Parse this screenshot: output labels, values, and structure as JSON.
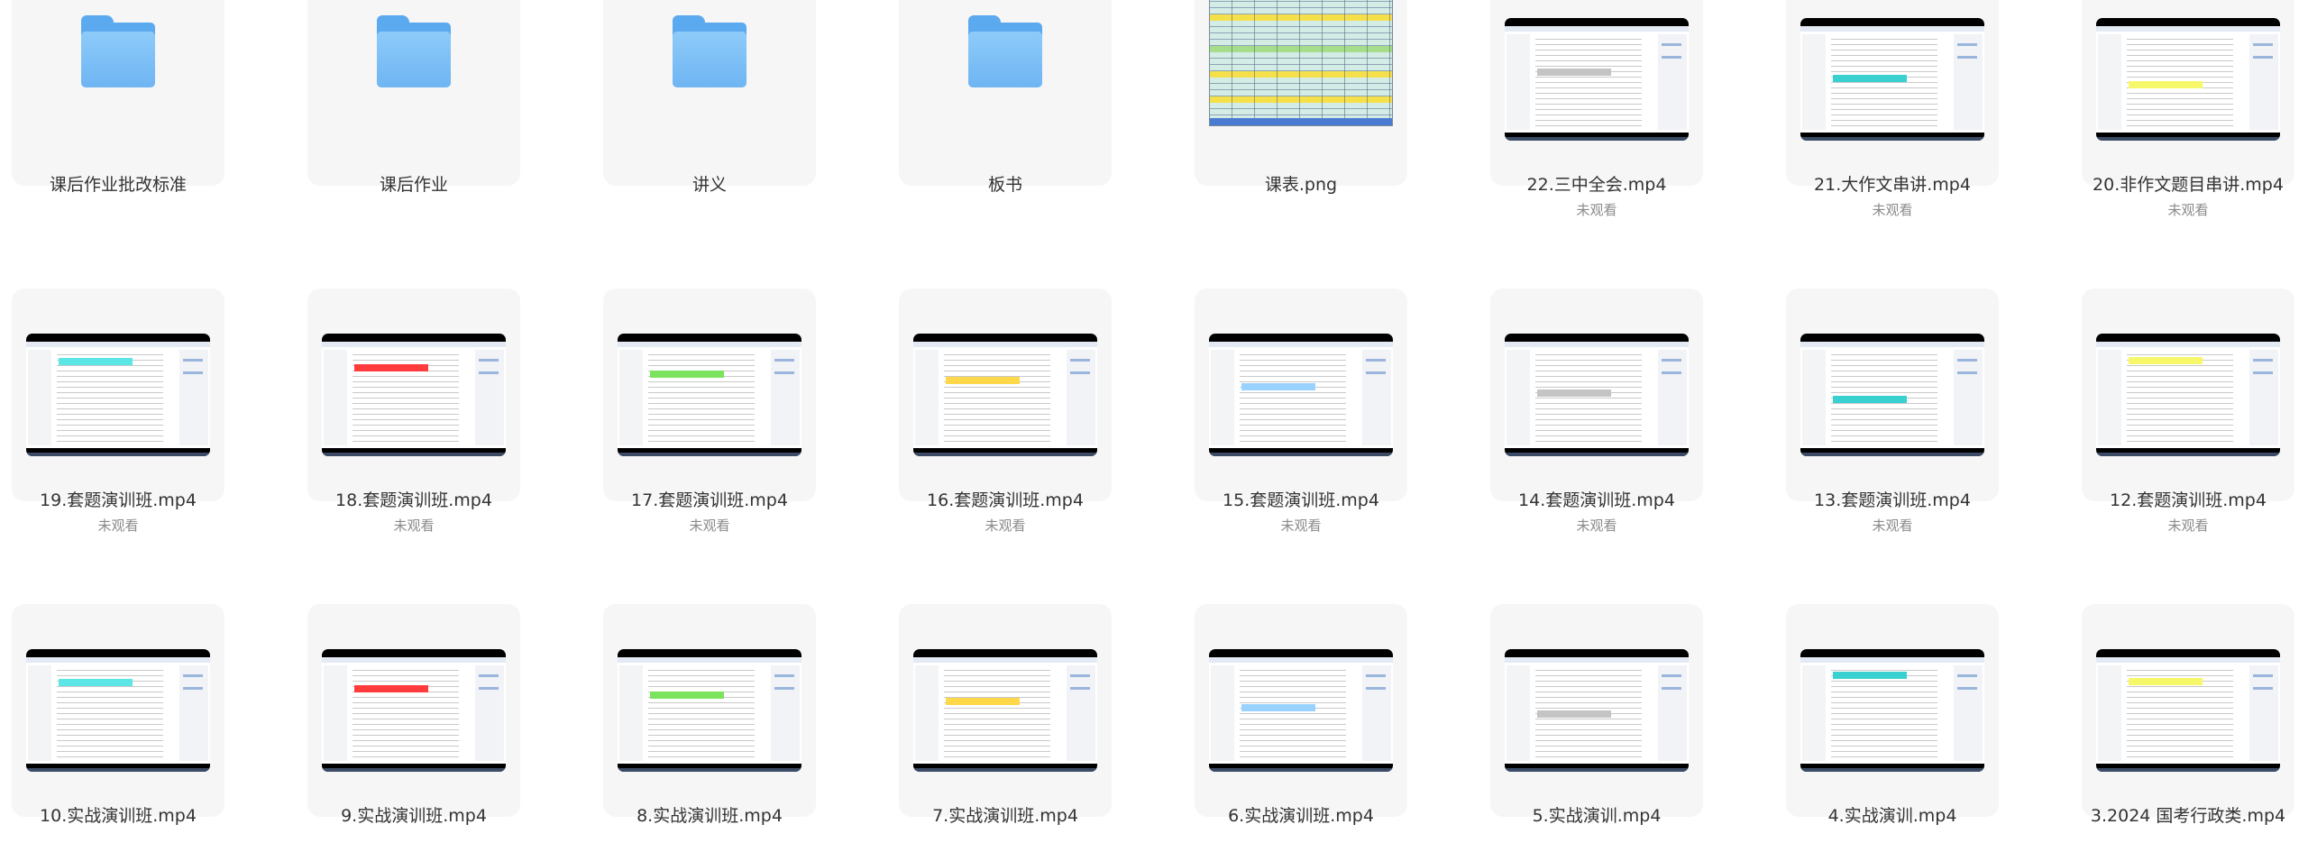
{
  "items": [
    {
      "name": "课后作业批改标准",
      "kind": "folder",
      "status": ""
    },
    {
      "name": "课后作业",
      "kind": "folder",
      "status": ""
    },
    {
      "name": "讲义",
      "kind": "folder",
      "status": ""
    },
    {
      "name": "板书",
      "kind": "folder",
      "status": ""
    },
    {
      "name": "课表.png",
      "kind": "image",
      "status": ""
    },
    {
      "name": "22.三中全会.mp4",
      "kind": "video",
      "status": "未观看"
    },
    {
      "name": "21.大作文串讲.mp4",
      "kind": "video",
      "status": "未观看"
    },
    {
      "name": "20.非作文题目串讲.mp4",
      "kind": "video",
      "status": "未观看"
    },
    {
      "name": "19.套题演训班.mp4",
      "kind": "video",
      "status": "未观看"
    },
    {
      "name": "18.套题演训班.mp4",
      "kind": "video",
      "status": "未观看"
    },
    {
      "name": "17.套题演训班.mp4",
      "kind": "video",
      "status": "未观看"
    },
    {
      "name": "16.套题演训班.mp4",
      "kind": "video",
      "status": "未观看"
    },
    {
      "name": "15.套题演训班.mp4",
      "kind": "video",
      "status": "未观看"
    },
    {
      "name": "14.套题演训班.mp4",
      "kind": "video",
      "status": "未观看"
    },
    {
      "name": "13.套题演训班.mp4",
      "kind": "video",
      "status": "未观看"
    },
    {
      "name": "12.套题演训班.mp4",
      "kind": "video",
      "status": "未观看"
    },
    {
      "name": "10.实战演训班.mp4",
      "kind": "video",
      "status": ""
    },
    {
      "name": "9.实战演训班.mp4",
      "kind": "video",
      "status": ""
    },
    {
      "name": "8.实战演训班.mp4",
      "kind": "video",
      "status": ""
    },
    {
      "name": "7.实战演训班.mp4",
      "kind": "video",
      "status": ""
    },
    {
      "name": "6.实战演训班.mp4",
      "kind": "video",
      "status": ""
    },
    {
      "name": "5.实战演训.mp4",
      "kind": "video",
      "status": ""
    },
    {
      "name": "4.实战演训.mp4",
      "kind": "video",
      "status": ""
    },
    {
      "name": "3.2024 国考行政类.mp4",
      "kind": "video",
      "status": ""
    }
  ],
  "colors": {
    "folder": "#6eb5f3",
    "tile_bg": "#f6f6f7",
    "text": "#333333",
    "status_text": "#8a8a8a"
  }
}
